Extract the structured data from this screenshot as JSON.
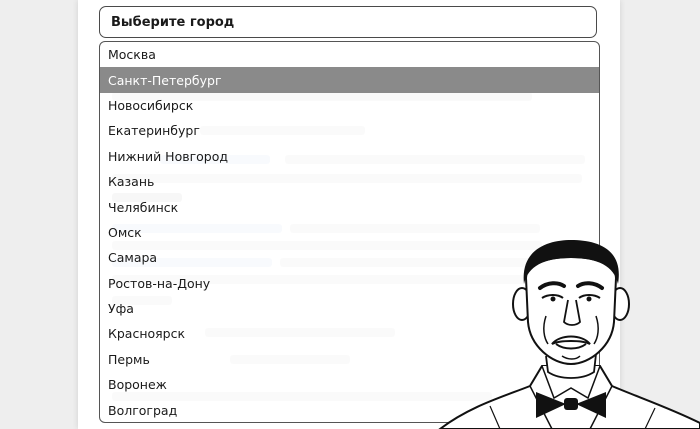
{
  "select": {
    "header_label": "Выберите город",
    "selected_index": 1,
    "options": [
      "Москва",
      "Санкт-Петербург",
      "Новосибирск",
      "Екатеринбург",
      "Нижний Новгород",
      "Казань",
      "Челябинск",
      "Омск",
      "Самара",
      "Ростов-на-Дону",
      "Уфа",
      "Красноярск",
      "Пермь",
      "Воронеж",
      "Волгоград"
    ]
  },
  "colors": {
    "page_background": "#eeeeee",
    "card_background": "#ffffff",
    "selected_option_background": "#8a8a8a",
    "selected_option_text": "#ffffff",
    "option_text": "#1a1a1a",
    "border": "#4a4a4a"
  },
  "meme": {
    "icon": "not-bad-meme-face"
  }
}
